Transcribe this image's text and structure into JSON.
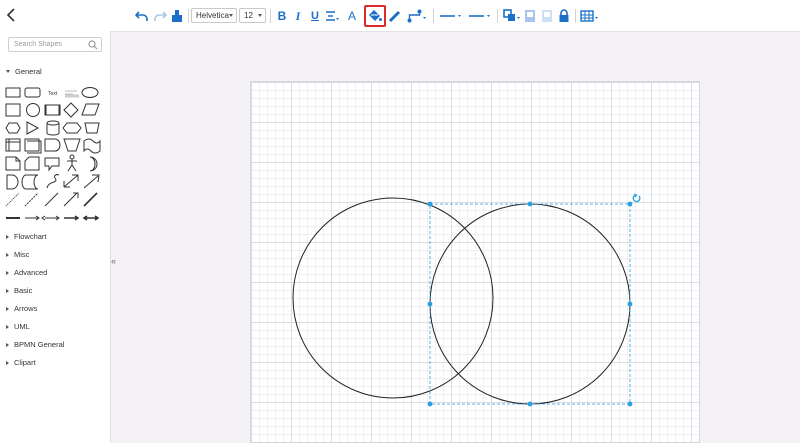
{
  "toolbar": {
    "font_family": "Helvetica",
    "font_size": "12",
    "text_color_glyph": "A",
    "bold_glyph": "B",
    "italic_glyph": "I",
    "underline_glyph": "U",
    "highlighted_tool": "fill-color-button",
    "accent_color": "#1b6fc9",
    "highlight_color": "#e02a2a"
  },
  "sidebar": {
    "search_placeholder": "Search Shapes",
    "general_label": "General",
    "text_shape_label": "Text",
    "categories": [
      "Flowchart",
      "Misc",
      "Advanced",
      "Basic",
      "Arrows",
      "UML",
      "BPMN General",
      "Clipart"
    ],
    "collapse_glyph": "«"
  },
  "canvas": {
    "shapes": [
      "circle",
      "circle"
    ],
    "selected_shape": "right circle",
    "selection_color": "#29a0e0"
  }
}
